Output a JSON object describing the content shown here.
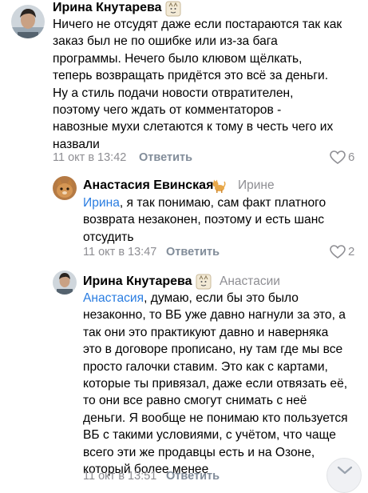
{
  "comments": [
    {
      "author": "Ирина Кнутарева",
      "reply_to": "",
      "lines": [
        "Ничего не отсудят даже если постараются так как",
        "заказ был не по ошибке или из-за бага",
        "программы. Нечего было клювом щёлкать,",
        "теперь возвращать придётся это всё за деньги.",
        "Ну а стиль подачи новости отвратителен,",
        "поэтому чего ждать от комментаторов -",
        "навозные мухи слетаются к тому в честь чего их",
        "назвали"
      ],
      "timestamp": "11 окт в 13:42",
      "answer_label": "Ответить",
      "likes": "6"
    },
    {
      "author": "Анастасия Евинская",
      "reply_to": "Ирине",
      "mention": "Ирина",
      "lines": [
        ", я так понимаю, сам факт платного",
        "возврата незаконен, поэтому и есть шанс",
        "отсудить"
      ],
      "timestamp": "11 окт в 13:47",
      "answer_label": "Ответить",
      "likes": "2"
    },
    {
      "author": "Ирина Кнутарева",
      "reply_to": "Анастасии",
      "mention": "Анастасия",
      "lines": [
        ", думаю, если бы это было",
        "незаконно, то ВБ уже давно нагнули за это, а",
        "так они это практикуют давно и наверняка",
        "это в договоре прописано, ну там где мы все",
        "просто галочки ставим. Это как с картами,",
        "которые ты привязал, даже если отвязать её,",
        "то они все равно смогут снимать с неё",
        "деньги. Я вообще не понимаю кто пользуется",
        "ВБ с такими условиями, с учётом, что чаще",
        "всего эти же продавцы есть и на Озоне,",
        "который более менее"
      ],
      "timestamp": "11 окт в 13:51",
      "answer_label": "Ответить",
      "likes": ""
    }
  ],
  "icons": {
    "author_badge_1": "cat-face-icon",
    "author_badge_2": "cat-icon",
    "like": "heart-icon",
    "scroll_down": "chevron-down-icon"
  },
  "colors": {
    "mention": "#2a7de1",
    "meta": "#8e8e93"
  }
}
